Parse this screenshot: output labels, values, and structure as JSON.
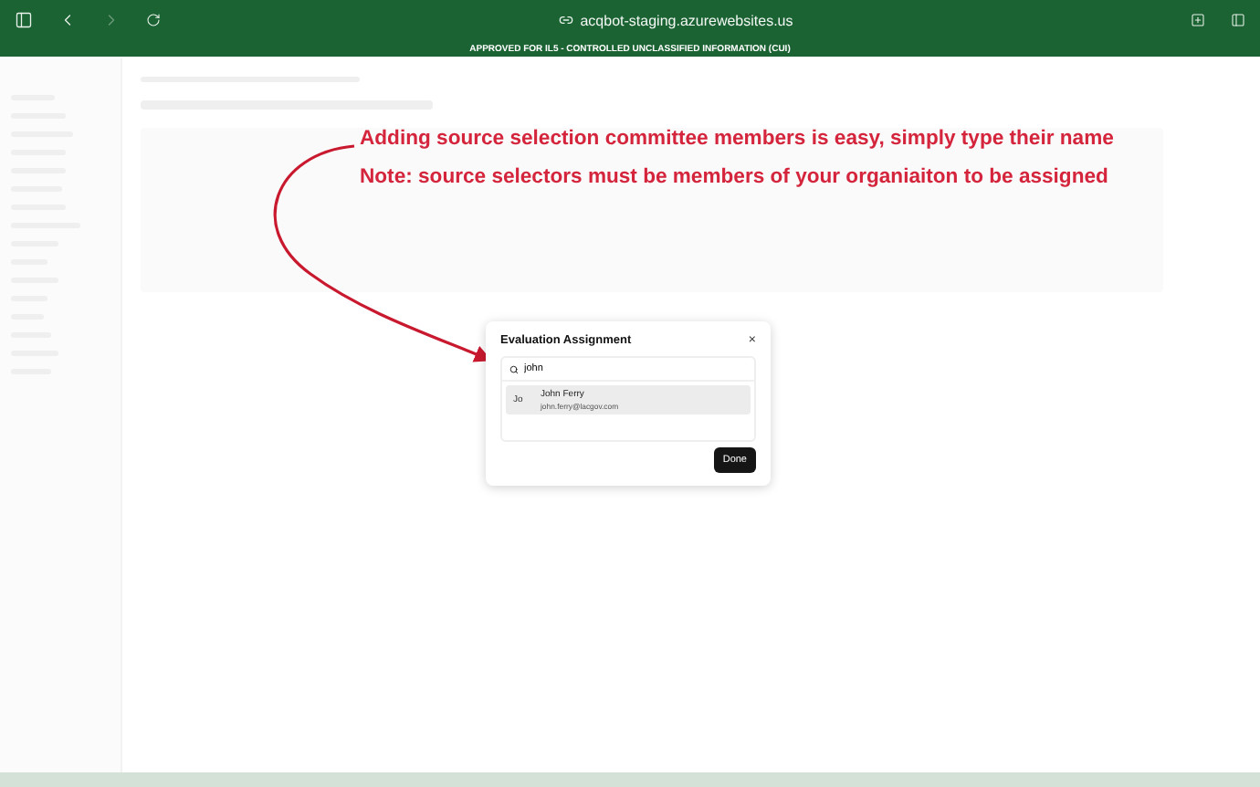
{
  "browser": {
    "url": "acqbot-staging.azurewebsites.us"
  },
  "banner": "APPROVED FOR IL5 - CONTROLLED UNCLASSIFIED INFORMATION (CUI)",
  "annotations": [
    "Adding source selection committee members is easy, simply type their name",
    "Note: source selectors must be members of your organiaiton to be assigned"
  ],
  "modal": {
    "title": "Evaluation Assignment",
    "close": "×",
    "search": {
      "value": "john"
    },
    "results": [
      {
        "initials": "Jo",
        "name": "John Ferry",
        "email": "john.ferry@lacgov.com",
        "selected": true
      }
    ],
    "button": "Done"
  }
}
